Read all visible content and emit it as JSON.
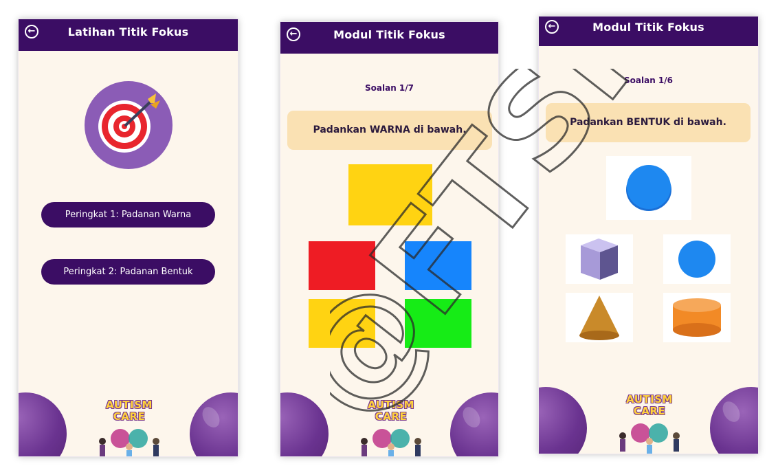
{
  "screens": [
    {
      "title": "Latihan Titik Fokus",
      "back_icon": "arrow-left-circle-icon",
      "hero_icon": "target-dart-icon",
      "levels": [
        {
          "label": "Peringkat 1: Padanan Warna"
        },
        {
          "label": "Peringkat 2: Padanan Bentuk"
        }
      ]
    },
    {
      "title": "Modul Titik Fokus",
      "back_icon": "arrow-left-circle-icon",
      "question_count": "Soalan 1/7",
      "instruction": "Padankan WARNA di bawah.",
      "target_color": "#ffd312",
      "options": [
        {
          "name": "red",
          "color": "#ee1c24"
        },
        {
          "name": "blue",
          "color": "#1685fc"
        },
        {
          "name": "yellow",
          "color": "#ffd312"
        },
        {
          "name": "green",
          "color": "#16ec16"
        }
      ]
    },
    {
      "title": "Modul Titik Fokus",
      "back_icon": "arrow-left-circle-icon",
      "question_count": "Soalan 1/6",
      "instruction": "Padankan BENTUK di bawah.",
      "target_shape": "circle",
      "options": [
        {
          "shape": "cube"
        },
        {
          "shape": "circle"
        },
        {
          "shape": "cone"
        },
        {
          "shape": "cylinder"
        }
      ]
    }
  ],
  "footer": {
    "logo_line1": "AUTISM",
    "logo_line2": "CARE"
  },
  "colors": {
    "primary": "#3b0d64",
    "background": "#fdf6ec",
    "card": "#fae1b3",
    "blob": "#6a3390"
  },
  "watermark": "@FTSM"
}
